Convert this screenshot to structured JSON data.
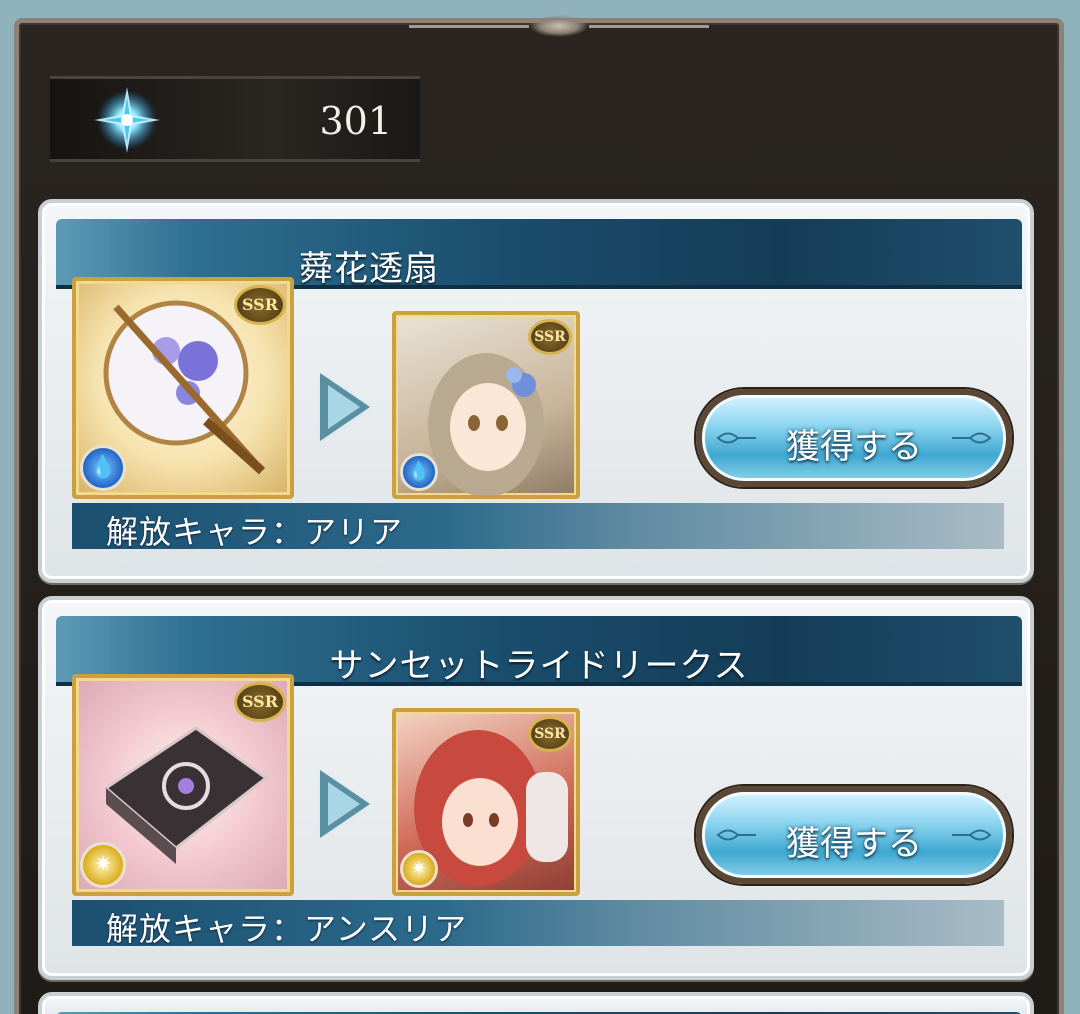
{
  "crystal": {
    "count": "301",
    "icon": "crystal-icon"
  },
  "cards": [
    {
      "title": "蕣花透扇",
      "item_rarity": "SSR",
      "char_rarity": "SSR",
      "element": "water",
      "element_icon": "💧",
      "button_label": "獲得する",
      "release_text": "解放キャラ：アリア"
    },
    {
      "title": "サンセットライドリークス",
      "item_rarity": "SSR",
      "char_rarity": "SSR",
      "element": "light",
      "element_icon": "✷",
      "button_label": "獲得する",
      "release_text": "解放キャラ：アンスリア"
    }
  ],
  "colors": {
    "banner": "#1a4e6e",
    "button": "#3fa8d1",
    "frame_gold": "#caa13e"
  }
}
